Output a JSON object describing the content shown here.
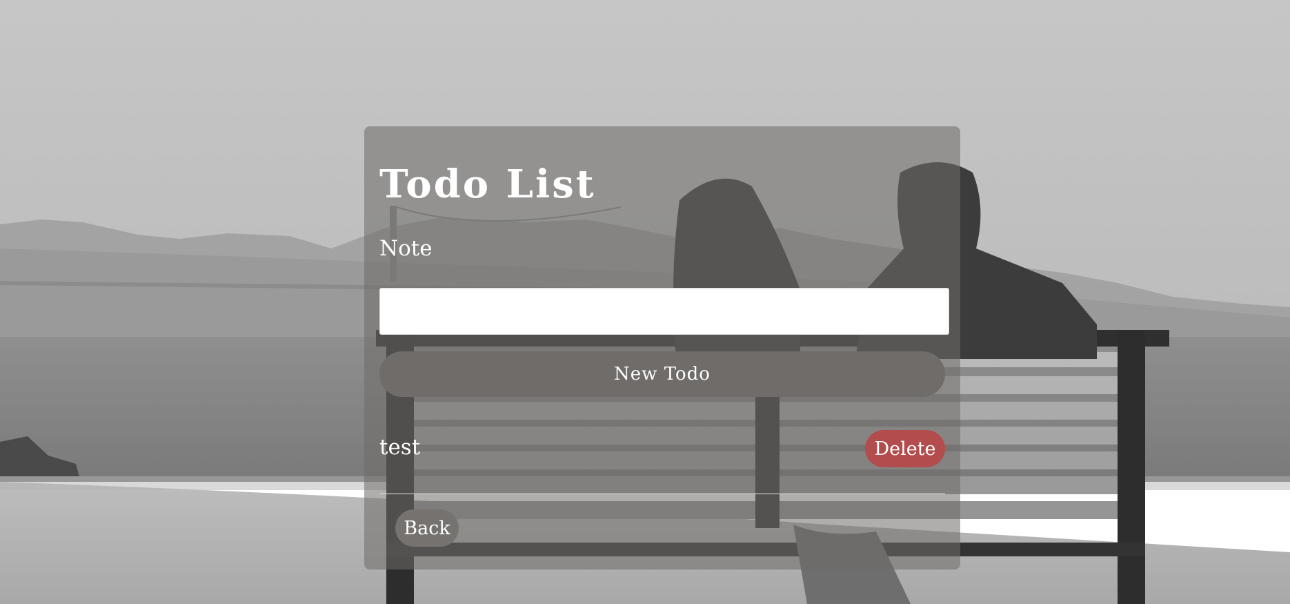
{
  "page": {
    "title": "Todo List",
    "note_label": "Note",
    "note_value": "",
    "new_button_label": "New Todo",
    "back_button_label": "Back"
  },
  "todos": [
    {
      "text": "test",
      "delete_label": "Delete"
    }
  ],
  "colors": {
    "panel_bg": "#6e6c6a",
    "button_gray": "#6f6c6a",
    "delete_red": "#b24c4d",
    "text_white": "#ffffff"
  },
  "background": {
    "description_icon": "beach-photo-background"
  }
}
